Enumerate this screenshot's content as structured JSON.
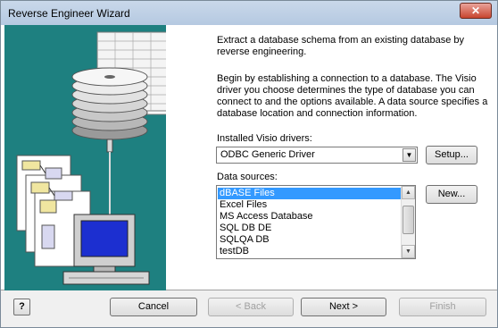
{
  "window": {
    "title": "Reverse Engineer Wizard",
    "close_glyph": "✕"
  },
  "intro": "Extract a database schema from an existing database by reverse engineering.",
  "description": "Begin by establishing a connection to a database.  The Visio driver you choose determines the type of database you can connect to and the options available.  A data source specifies a database location and connection information.",
  "drivers": {
    "label": "Installed Visio drivers:",
    "selected": "ODBC Generic Driver",
    "setup_label": "Setup..."
  },
  "data_sources": {
    "label": "Data sources:",
    "new_label": "New...",
    "items": [
      "dBASE Files",
      "Excel Files",
      "MS Access Database",
      "SQL DB DE",
      "SQLQA DB",
      "testDB"
    ],
    "selected_index": 0
  },
  "footer": {
    "help_glyph": "?",
    "cancel_label": "Cancel",
    "back_label": "< Back",
    "next_label": "Next >",
    "finish_label": "Finish"
  },
  "colors": {
    "art_panel": "#1e8080",
    "selection": "#3399ff"
  },
  "icons": {
    "illustration": "database-network-illustration",
    "close": "close-icon",
    "dropdown": "chevron-down-icon",
    "scroll_up": "scroll-up-icon",
    "scroll_down": "scroll-down-icon",
    "help": "help-icon"
  }
}
